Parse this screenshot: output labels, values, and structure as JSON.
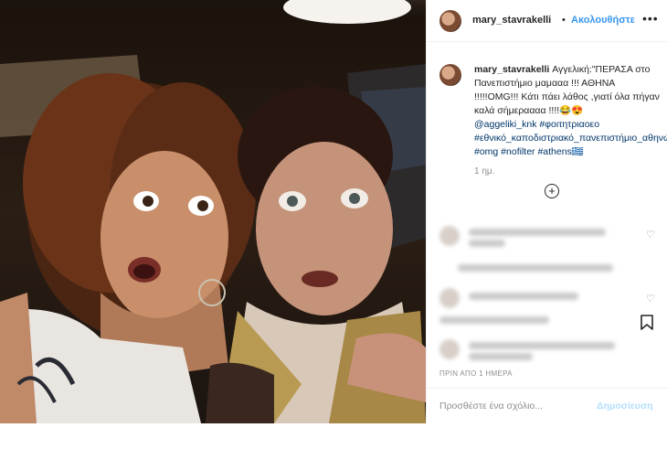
{
  "header": {
    "username": "mary_stavrakelli",
    "separator": "•",
    "follow_label": "Ακολουθήστε",
    "more_icon": "more-horizontal-icon"
  },
  "caption": {
    "username": "mary_stavrakelli",
    "line1": " Αγγελική:\"ΠΕΡΑΣΑ στο Πανεπιστήμιο μαμααα !!! ΑΘΗΝΑ !!!!!OMG!!! Κάτι πάει λάθος ,γιατί όλα πήγαν καλά σήμεραααα !!!!😂😍",
    "mention": "@aggeliki_knk",
    "tags": "#φοιτητριαοεο #εθνικό_καποδιστριακό_πανεπιστήμιο_αθηνών #omg #nofilter #athens🇬🇷",
    "time": "1 ημ."
  },
  "post_date": "ΠΡΙΝ ΑΠΟ 1 ΗΜΕΡΑ",
  "comment_bar": {
    "placeholder": "Προσθέστε ένα σχόλιο...",
    "post_label": "Δημοσίευση"
  },
  "colors": {
    "link_blue": "#3897f0",
    "post_disabled": "#b2dffc",
    "muted": "#8e8e8e",
    "hashtag": "#003569"
  }
}
